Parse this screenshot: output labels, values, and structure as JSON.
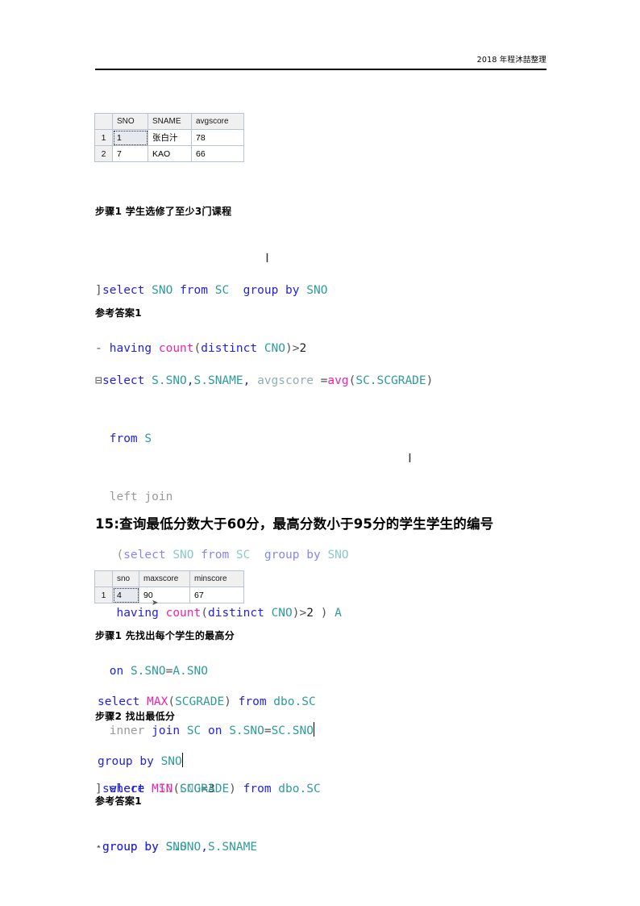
{
  "header": {
    "text": "2018 年程沐喆整理"
  },
  "tables": [
    {
      "name": "avgscore-result-grid",
      "columns": [
        "",
        "SNO",
        "SNAME",
        "avgscore"
      ],
      "rows": [
        {
          "rownum": "1",
          "cells": [
            "1",
            "张白汁",
            "78"
          ]
        },
        {
          "rownum": "2",
          "cells": [
            "7",
            "KAO",
            "66"
          ]
        }
      ]
    },
    {
      "name": "maxmin-result-grid",
      "columns": [
        "",
        "sno",
        "maxscore",
        "minscore"
      ],
      "rows": [
        {
          "rownum": "1",
          "cells": [
            "4",
            "90",
            "67"
          ]
        }
      ]
    }
  ],
  "headings": {
    "step1_a": "步骤1 学生选修了至少3门课程",
    "answer1_a": "参考答案1",
    "section15": "15:查询最低分数大于60分，最高分数小于95分的学生学生的编号",
    "step1_b": "步骤1 先找出每个学生的最高分",
    "step2_b": "步骤2 找出最低分",
    "answer1_b": "参考答案1"
  },
  "code_blocks": {
    "block1": {
      "name": "sql-step1-having-count",
      "lines": [
        "select SNO from SC  group by SNO",
        " having count(distinct CNO)>2"
      ],
      "markers": [
        "]",
        "-"
      ]
    },
    "block2": {
      "name": "sql-answer1-left-join",
      "lines": [
        "select S.SNO,S.SNAME, avgscore =avg(SC.SCGRADE)",
        "from S",
        "left join",
        "  (select SNO from SC  group by SNO",
        "  having count(distinct CNO)>2 ) A",
        "on S.SNO=A.SNO",
        "inner join SC on S.SNO=SC.SNO",
        "where  SC.CNO=3",
        "group by S.SNO,S.SNAME"
      ],
      "markers": [
        "=",
        "",
        "",
        "",
        "",
        "",
        "",
        "",
        "-"
      ]
    },
    "block3": {
      "name": "sql-max-scgrade",
      "lines": [
        "select MAX(SCGRADE) from dbo.SC",
        "group by SNO"
      ],
      "markers": [
        "",
        ""
      ]
    },
    "block4": {
      "name": "sql-min-scgrade",
      "lines": [
        "select MIN(SCGRADE) from dbo.SC",
        "group by SNO"
      ],
      "markers": [
        "]",
        "."
      ]
    }
  }
}
